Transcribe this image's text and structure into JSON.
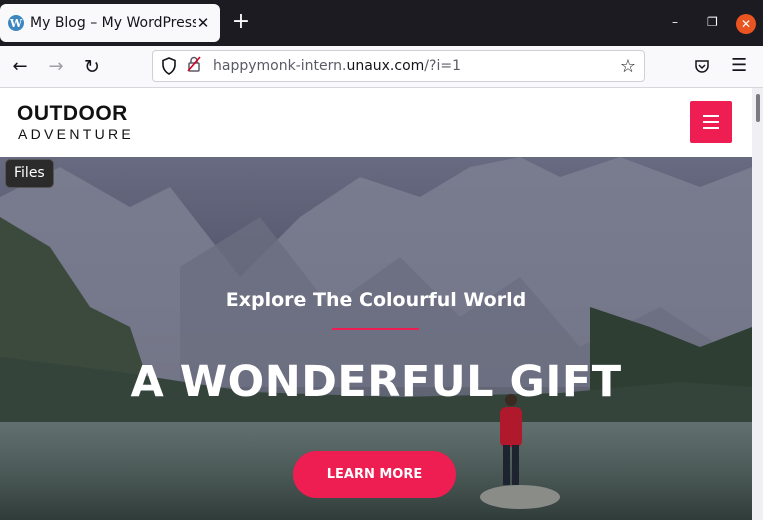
{
  "browser": {
    "tab_title": "My Blog – My WordPress",
    "tab_icon": "wordpress-icon",
    "new_tab": "+",
    "url_prefix": "happymonk-intern.",
    "url_domain": "unaux.com",
    "url_suffix": "/?i=1"
  },
  "site": {
    "logo_line1": "OUTDOOR",
    "logo_line2": "ADVENTURE",
    "accent_color": "#ee1d52"
  },
  "hero": {
    "files_label": "Files",
    "subtitle": "Explore The Colourful World",
    "title": "A WONDERFUL GIFT",
    "cta_label": "LEARN MORE"
  }
}
